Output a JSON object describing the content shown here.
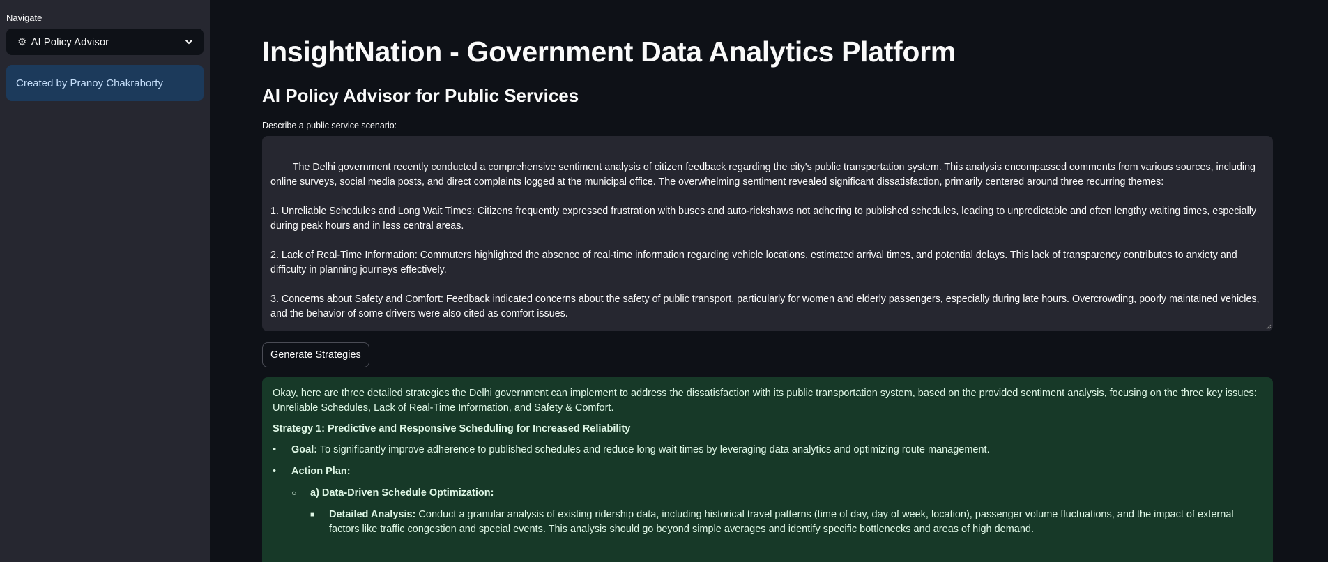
{
  "sidebar": {
    "nav_label": "Navigate",
    "selected_page": "AI Policy Advisor",
    "credit": "Created by Pranoy Chakraborty"
  },
  "main": {
    "title": "InsightNation - Government Data Analytics Platform",
    "subtitle": "AI Policy Advisor for Public Services",
    "input_label": "Describe a public service scenario:",
    "scenario_text": "The Delhi government recently conducted a comprehensive sentiment analysis of citizen feedback regarding the city's public transportation system. This analysis encompassed comments from various sources, including online surveys, social media posts, and direct complaints logged at the municipal office. The overwhelming sentiment revealed significant dissatisfaction, primarily centered around three recurring themes:\n\n1. Unreliable Schedules and Long Wait Times: Citizens frequently expressed frustration with buses and auto-rickshaws not adhering to published schedules, leading to unpredictable and often lengthy waiting times, especially during peak hours and in less central areas.\n\n2. Lack of Real-Time Information: Commuters highlighted the absence of real-time information regarding vehicle locations, estimated arrival times, and potential delays. This lack of transparency contributes to anxiety and difficulty in planning journeys effectively.\n\n3. Concerns about Safety and Comfort: Feedback indicated concerns about the safety of public transport, particularly for women and elderly passengers, especially during late hours. Overcrowding, poorly maintained vehicles, and the behavior of some drivers were also cited as comfort issues.",
    "generate_button": "Generate Strategies"
  },
  "result": {
    "intro": "Okay, here are three detailed strategies the Delhi government can implement to address the dissatisfaction with its public transportation system, based on the provided sentiment analysis, focusing on the three key issues: Unreliable Schedules, Lack of Real-Time Information, and Safety & Comfort.",
    "strategy1_heading": "Strategy 1: Predictive and Responsive Scheduling for Increased Reliability",
    "goal_label": "Goal:",
    "goal_text": " To significantly improve adherence to published schedules and reduce long wait times by leveraging data analytics and optimizing route management.",
    "action_plan_label": "Action Plan:",
    "subitem_a": "a) Data-Driven Schedule Optimization:",
    "detail_label": "Detailed Analysis:",
    "detail_text": " Conduct a granular analysis of existing ridership data, including historical travel patterns (time of day, day of week, location), passenger volume fluctuations, and the impact of external factors like traffic congestion and special events. This analysis should go beyond simple averages and identify specific bottlenecks and areas of high demand."
  },
  "colors": {
    "app_bg": "#0e1117",
    "sidebar_bg": "#262730",
    "info_bg": "#1c3a5b",
    "success_bg": "#173928"
  }
}
